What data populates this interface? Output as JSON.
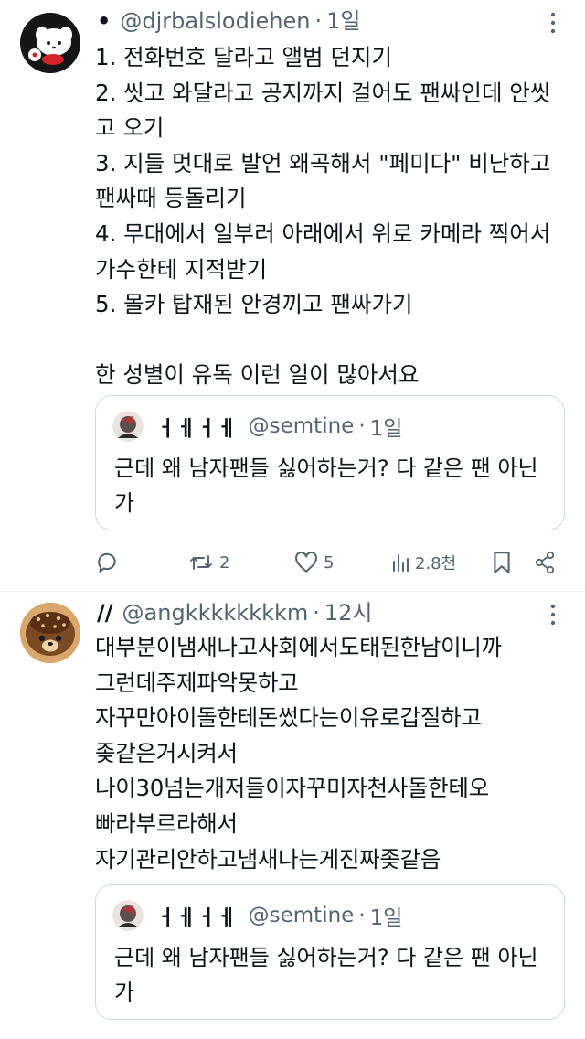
{
  "tweets": [
    {
      "display_name": "•",
      "handle": "@djrbalslodiehen",
      "dot": "·",
      "time": "1일",
      "text": "1. 전화번호 달라고 앨범 던지기\n2. 씻고 와달라고 공지까지 걸어도 팬싸인데 안씻고 오기\n3. 지들 멋대로 발언 왜곡해서 \"페미다\" 비난하고 팬싸때 등돌리기\n4. 무대에서 일부러 아래에서 위로 카메라 찍어서 가수한테 지적받기\n5. 몰카 탑재된 안경끼고 팬싸가기\n\n한 성별이 유독 이런 일이 많아서요",
      "quote": {
        "display_name": "ㅓㅔㅓㅔ",
        "handle": "@semtine",
        "dot": "·",
        "time": "1일",
        "text": "근데 왜 남자팬들 싫어하는거? 다 같은 팬 아닌가"
      },
      "stats": {
        "replies": "",
        "retweets": "2",
        "likes": "5",
        "views": "2.8천"
      }
    },
    {
      "display_name": "//",
      "handle": "@angkkkkkkkkm",
      "dot": "·",
      "time": "12시",
      "text": "대부분이냄새나고사회에서도태된한남이니까\n그런데주제파악못하고\n자꾸만아이돌한테돈썼다는이유로갑질하고\n좆같은거시켜서\n나이30넘는개저들이자꾸미자천사돌한테오\n빠라부르라해서\n자기관리안하고냄새나는게진짜좆같음",
      "quote": {
        "display_name": "ㅓㅔㅓㅔ",
        "handle": "@semtine",
        "dot": "·",
        "time": "1일",
        "text": "근데 왜 남자팬들 싫어하는거? 다 같은 팬 아닌가"
      }
    }
  ],
  "icons": {
    "more": "more-vertical-icon",
    "reply": "reply-icon",
    "retweet": "retweet-icon",
    "like": "heart-icon",
    "views": "views-chart-icon",
    "bookmark": "bookmark-icon",
    "share": "share-icon"
  },
  "colors": {
    "text": "#0f1419",
    "secondary": "#536471",
    "border": "#cfd9de"
  }
}
